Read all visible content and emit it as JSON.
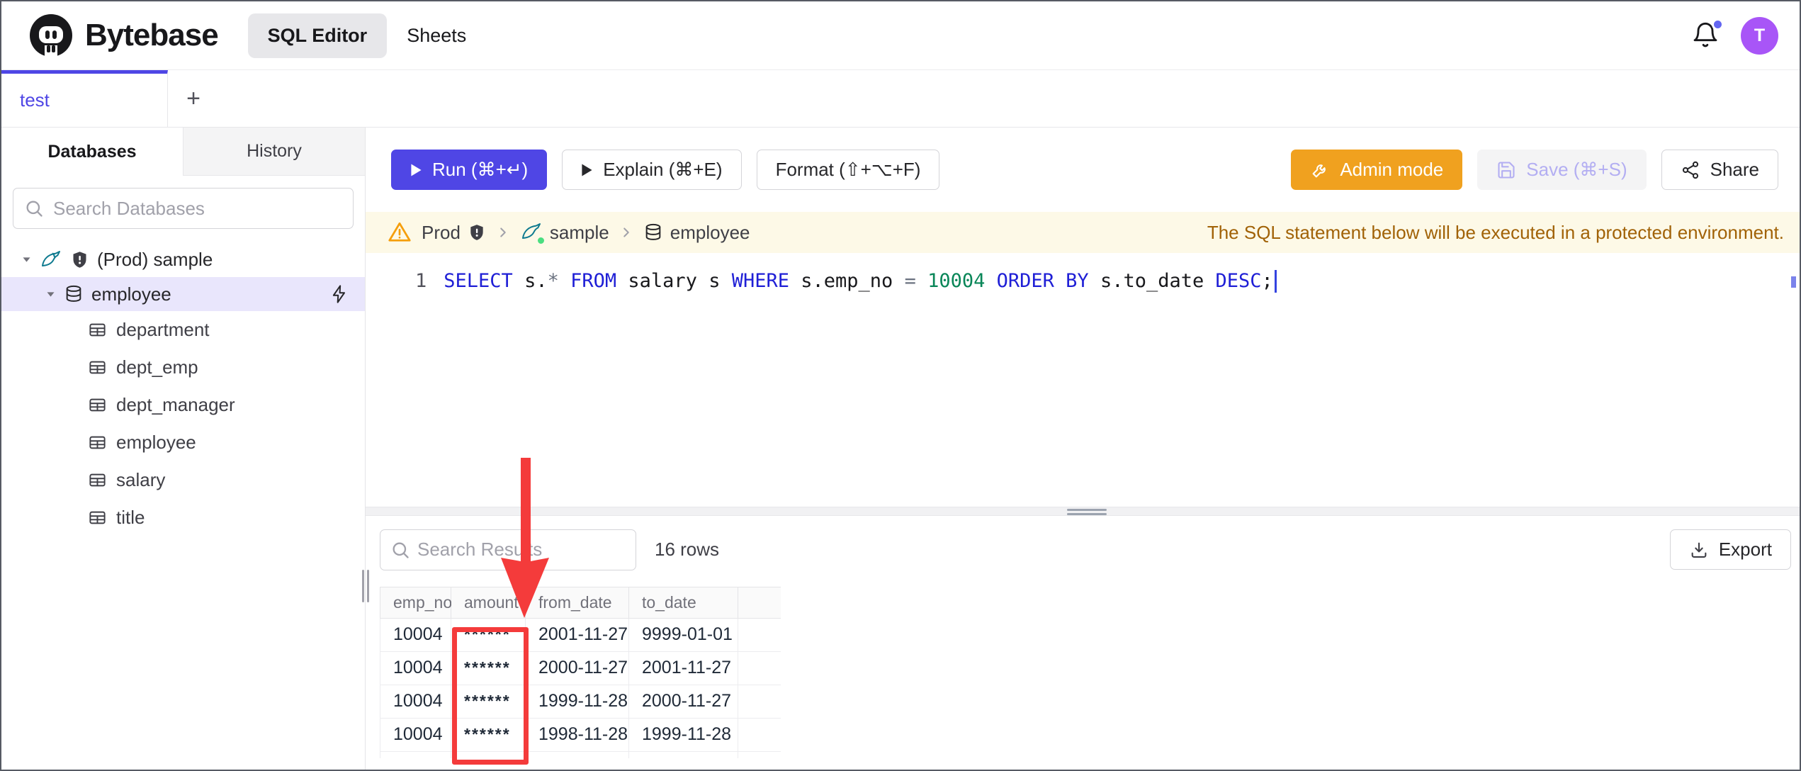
{
  "topbar": {
    "brand": "Bytebase",
    "nav_sql_editor": "SQL Editor",
    "nav_sheets": "Sheets",
    "avatar_initial": "T"
  },
  "tabs": {
    "active": "test",
    "add": "+"
  },
  "sidebar": {
    "tab_databases": "Databases",
    "tab_history": "History",
    "search_placeholder": "Search Databases",
    "tree": {
      "instance_label": "(Prod) sample",
      "database_label": "employee",
      "tables": [
        "department",
        "dept_emp",
        "dept_manager",
        "employee",
        "salary",
        "title"
      ]
    }
  },
  "toolbar": {
    "run_label": "Run (⌘+↵)",
    "explain_label": "Explain (⌘+E)",
    "format_label": "Format (⇧+⌥+F)",
    "admin_mode_label": "Admin mode",
    "save_label": "Save (⌘+S)",
    "share_label": "Share"
  },
  "breadcrumb": {
    "environment": "Prod",
    "database": "sample",
    "table": "employee",
    "notice": "The SQL statement below will be executed in a protected environment."
  },
  "editor": {
    "line_number": "1",
    "tokens": [
      {
        "text": "SELECT",
        "type": "keyword"
      },
      {
        "text": " s.",
        "type": "plain"
      },
      {
        "text": "*",
        "type": "operator"
      },
      {
        "text": " ",
        "type": "plain"
      },
      {
        "text": "FROM",
        "type": "keyword"
      },
      {
        "text": " salary s ",
        "type": "plain"
      },
      {
        "text": "WHERE",
        "type": "keyword"
      },
      {
        "text": " s.emp_no ",
        "type": "plain"
      },
      {
        "text": "=",
        "type": "operator"
      },
      {
        "text": " ",
        "type": "plain"
      },
      {
        "text": "10004",
        "type": "number"
      },
      {
        "text": " ",
        "type": "plain"
      },
      {
        "text": "ORDER BY",
        "type": "keyword"
      },
      {
        "text": " s.to_date ",
        "type": "plain"
      },
      {
        "text": "DESC",
        "type": "keyword"
      },
      {
        "text": ";",
        "type": "plain"
      }
    ]
  },
  "results": {
    "search_placeholder": "Search Results",
    "row_count": "16 rows",
    "export_label": "Export",
    "table": {
      "columns": [
        "emp_no",
        "amount",
        "from_date",
        "to_date"
      ],
      "rows": [
        [
          "10004",
          "******",
          "2001-11-27",
          "9999-01-01"
        ],
        [
          "10004",
          "******",
          "2000-11-27",
          "2001-11-27"
        ],
        [
          "10004",
          "******",
          "1999-11-28",
          "2000-11-27"
        ],
        [
          "10004",
          "******",
          "1998-11-28",
          "1999-11-28"
        ]
      ]
    }
  },
  "colors": {
    "accent_indigo": "#4f46e5",
    "admin_orange": "#f0a11f",
    "annotation_red": "#f43b3b",
    "notice_bg": "#fdf9e7",
    "notice_text": "#a16207",
    "avatar_purple": "#a855f7",
    "sql_keyword_blue": "#1f1fd6",
    "sql_number_green": "#098658",
    "selected_tree_bg": "#e9e6fc"
  }
}
